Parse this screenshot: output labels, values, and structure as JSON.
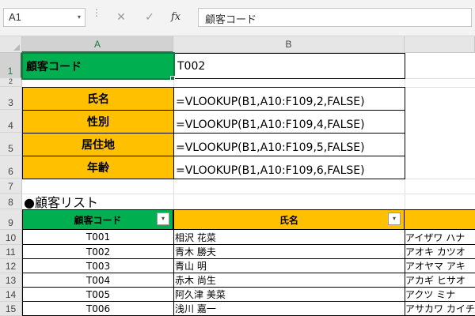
{
  "formula_bar": {
    "name_box": "A1",
    "name_dropdown_icon": "▾",
    "cancel_icon": "✕",
    "enter_icon": "✓",
    "fx_label": "fx",
    "formula": "顧客コード"
  },
  "columns": [
    "A",
    "B"
  ],
  "rows": [
    "1",
    "2",
    "3",
    "4",
    "5",
    "6",
    "7",
    "8",
    "9",
    "10",
    "11",
    "12",
    "13",
    "14",
    "15"
  ],
  "lookup": {
    "key_label": "顧客コード",
    "key_value": "T002",
    "fields": [
      {
        "label": "氏名",
        "formula": "=VLOOKUP(B1,A10:F109,2,FALSE)"
      },
      {
        "label": "性別",
        "formula": "=VLOOKUP(B1,A10:F109,4,FALSE)"
      },
      {
        "label": "居住地",
        "formula": "=VLOOKUP(B1,A10:F109,5,FALSE)"
      },
      {
        "label": "年齢",
        "formula": "=VLOOKUP(B1,A10:F109,6,FALSE)"
      }
    ]
  },
  "list": {
    "title": "●顧客リスト",
    "headers": [
      "顧客コード",
      "氏名"
    ],
    "rows": [
      {
        "code": "T001",
        "name": "相沢 花菜",
        "kana": "アイザワ ハナ"
      },
      {
        "code": "T002",
        "name": "青木 勝夫",
        "kana": "アオキ カツオ"
      },
      {
        "code": "T003",
        "name": "青山 明",
        "kana": "アオヤマ アキ"
      },
      {
        "code": "T004",
        "name": "赤木 尚生",
        "kana": "アカギ ヒサオ"
      },
      {
        "code": "T005",
        "name": "阿久津 美菜",
        "kana": "アクツ ミナ"
      },
      {
        "code": "T006",
        "name": "浅川 嘉一",
        "kana": "アサカワ カイチ"
      }
    ]
  },
  "colors": {
    "green": "#00b050",
    "orange": "#ffc000",
    "selection": "#217346"
  }
}
